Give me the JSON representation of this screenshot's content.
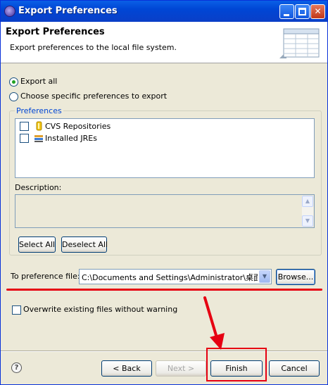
{
  "window": {
    "title": "Export Preferences",
    "buttons": {
      "minimize": "minimize",
      "maximize": "maximize",
      "close": "✕"
    }
  },
  "banner": {
    "title": "Export Preferences",
    "description": "Export preferences to the local file system."
  },
  "options": {
    "export_all": "Export all",
    "choose_specific": "Choose specific preferences to export",
    "selected": "export_all"
  },
  "preferences": {
    "group_label": "Preferences",
    "items": [
      {
        "label": "CVS Repositories",
        "icon": "cvs-repository-icon",
        "checked": false
      },
      {
        "label": "Installed JREs",
        "icon": "jre-icon",
        "checked": false
      }
    ]
  },
  "description": {
    "label": "Description:"
  },
  "selection_buttons": {
    "select_all": "Select All",
    "deselect_all": "Deselect All"
  },
  "target": {
    "label": "To preference file:",
    "value": "C:\\Documents and Settings\\Administrator\\桌面\\test",
    "browse": "Browse..."
  },
  "overwrite": {
    "label": "Overwrite existing files without warning",
    "checked": false
  },
  "footer": {
    "back": "< Back",
    "next": "Next >",
    "finish": "Finish",
    "cancel": "Cancel"
  },
  "colors": {
    "annotation_red": "#e60012",
    "title_bar_blue": "#0046d5"
  }
}
